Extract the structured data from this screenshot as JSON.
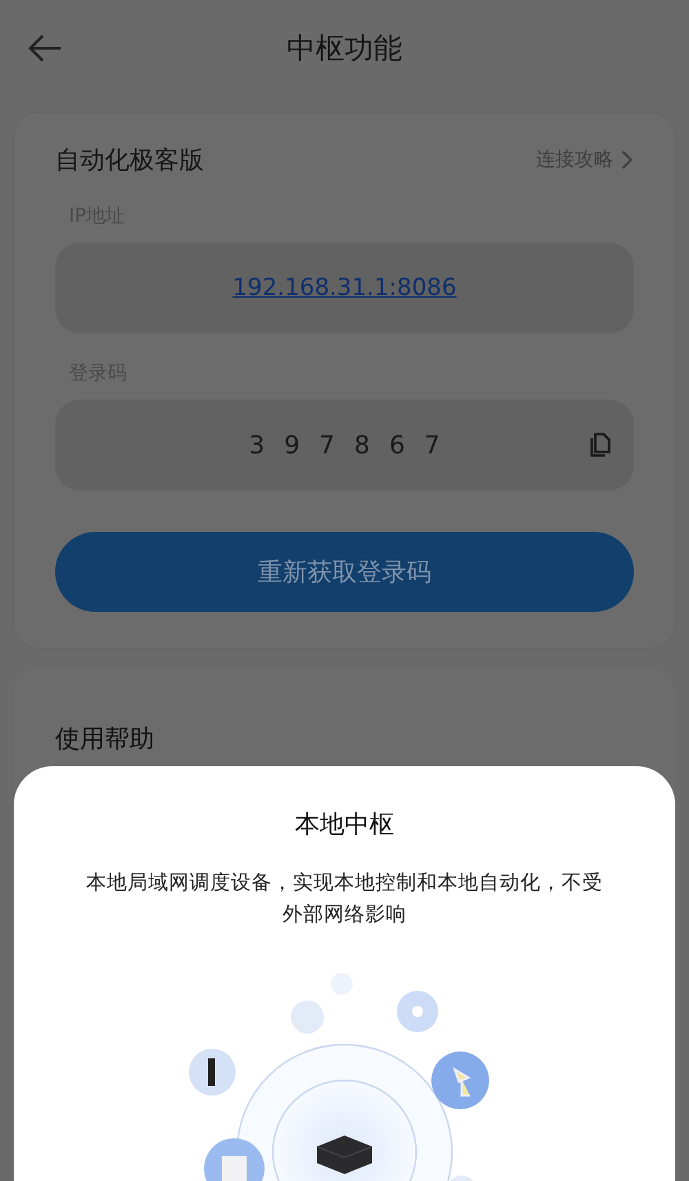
{
  "header": {
    "title": "中枢功能"
  },
  "hub_card": {
    "title": "自动化极客版",
    "guide_link": "连接攻略",
    "ip_label": "IP地址",
    "ip_address": "192.168.31.1:8086",
    "code_label": "登录码",
    "login_code": "397867",
    "refresh_button": "重新获取登录码"
  },
  "help_row": {
    "label": "使用帮助"
  },
  "sheet": {
    "title": "本地中枢",
    "description": "本地局域网调度设备，实现本地控制和本地自动化，不受外部网络影响"
  }
}
